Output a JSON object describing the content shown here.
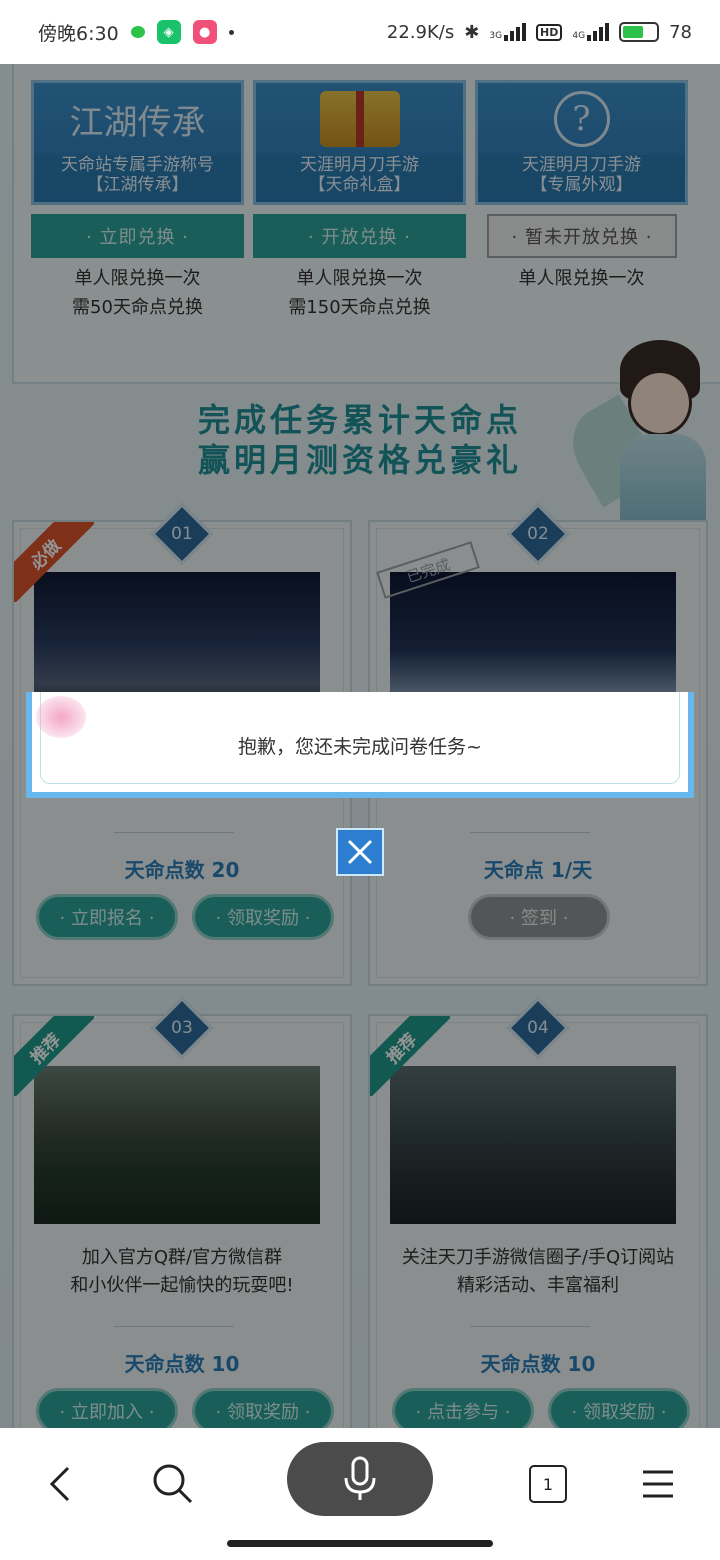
{
  "status_bar": {
    "time": "傍晚6:30",
    "net_speed": "22.9K/s",
    "signal_1": "3G",
    "hd": "HD",
    "signal_2": "4G",
    "battery": "78"
  },
  "exchange": {
    "items": [
      {
        "art": "江湖传承",
        "title_line1": "天命站专属手游称号",
        "title_line2": "【江湖传承】",
        "button": "· 立即兑换 ·",
        "note_line1": "单人限兑换一次",
        "note_line2": "需50天命点兑换"
      },
      {
        "art": "",
        "title_line1": "天涯明月刀手游",
        "title_line2": "【天命礼盒】",
        "button": "· 开放兑换 ·",
        "note_line1": "单人限兑换一次",
        "note_line2": "需150天命点兑换"
      },
      {
        "art": "?",
        "title_line1": "天涯明月刀手游",
        "title_line2": "【专属外观】",
        "button": "· 暂未开放兑换 ·",
        "note_line1": "单人限兑换一次",
        "note_line2": ""
      }
    ]
  },
  "headline": {
    "line1": "完成任务累计天命点",
    "line2": "赢明月测资格兑豪礼"
  },
  "tasks": [
    {
      "num": "01",
      "ribbon": "必做",
      "desc_line1": "",
      "desc_line2": "",
      "points": "天命点数 20",
      "btn1": "· 立即报名 ·",
      "btn2": "· 领取奖励 ·"
    },
    {
      "num": "02",
      "stamp": "已完成",
      "desc_line1": "",
      "desc_line2": "",
      "points": "天命点 1/天",
      "btn1": "· 签到 ·"
    },
    {
      "num": "03",
      "ribbon": "推荐",
      "desc_line1": "加入官方Q群/官方微信群",
      "desc_line2": "和小伙伴一起愉快的玩耍吧!",
      "points": "天命点数 10",
      "btn1": "· 立即加入 ·",
      "btn2": "· 领取奖励 ·"
    },
    {
      "num": "04",
      "ribbon": "推荐",
      "desc_line1": "关注天刀手游微信圈子/手Q订阅站",
      "desc_line2": "精彩活动、丰富福利",
      "points": "天命点数 10",
      "btn1": "· 点击参与 ·",
      "btn2": "· 领取奖励 ·"
    }
  ],
  "modal": {
    "message": "抱歉，您还未完成问卷任务~"
  },
  "nav": {
    "tabs_count": "1"
  },
  "colors": {
    "accent_teal": "#2ba39a",
    "points_blue": "#2a7fb8",
    "headline_teal": "#1e8f96",
    "modal_border": "#68b7ec",
    "ribbon_red": "#d9532b",
    "ribbon_teal": "#1f9a8c"
  }
}
